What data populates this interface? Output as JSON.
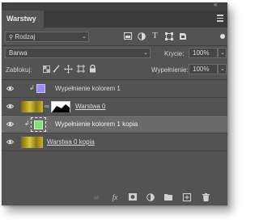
{
  "panel": {
    "tab_label": "Warstwy",
    "collapse_glyph": "«"
  },
  "filter": {
    "kind_label": "Rodzaj",
    "icons": [
      "image-filter-icon",
      "adjustment-filter-icon",
      "type-filter-icon",
      "shape-filter-icon",
      "smart-object-filter-icon"
    ]
  },
  "blend": {
    "mode": "Barwa",
    "opacity_label": "Krycie:",
    "opacity_value": "100%"
  },
  "lock": {
    "label": "Zablokuj:",
    "fill_label": "Wypełnienie:",
    "fill_value": "100%"
  },
  "layers": [
    {
      "name": "Wypełnienie kolorem 1",
      "swatch": "#9b8cf5",
      "selected": false,
      "underlined": false
    },
    {
      "name": "Warstwa 0",
      "selected": false,
      "underlined": true
    },
    {
      "name": "Wypełnienie kolorem 1 kopia",
      "swatch": "#7ee27a",
      "selected": true,
      "underlined": false
    },
    {
      "name": "Warstwa 0 kopia",
      "selected": false,
      "underlined": true
    }
  ],
  "colors": {
    "panel_bg": "#535353",
    "selected_row": "#6a6a6a",
    "thumb_gold": "#b5a31a"
  }
}
